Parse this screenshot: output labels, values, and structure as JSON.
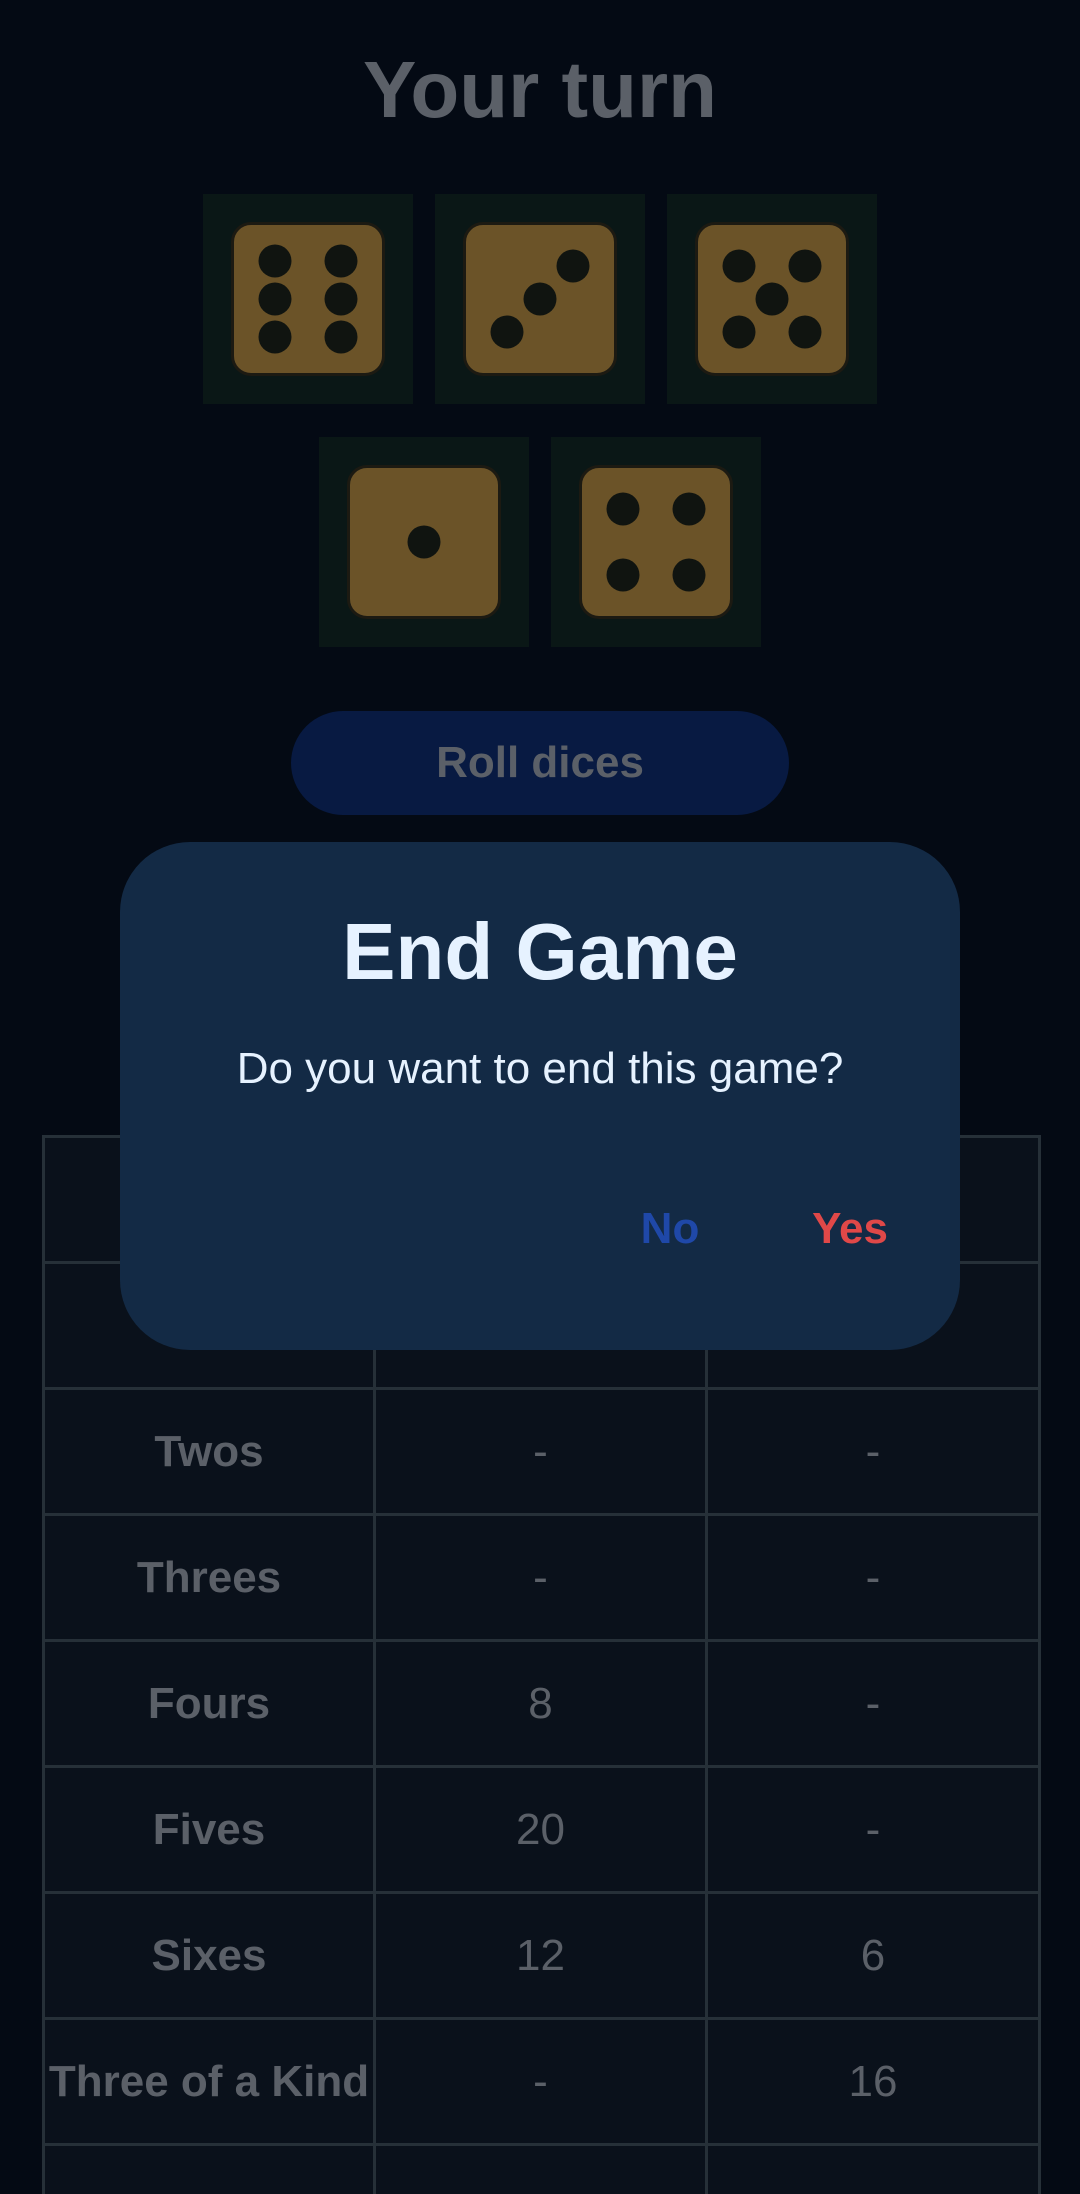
{
  "header": {
    "title": "Your turn"
  },
  "dice": [
    6,
    3,
    5,
    1,
    4
  ],
  "roll_button": {
    "label": "Roll dices"
  },
  "scoreboard": {
    "columns": [
      "",
      "",
      ""
    ],
    "rows": [
      {
        "label": "",
        "p1": "",
        "p2": ""
      },
      {
        "label": "Twos",
        "p1": "-",
        "p2": "-"
      },
      {
        "label": "Threes",
        "p1": "-",
        "p2": "-"
      },
      {
        "label": "Fours",
        "p1": "8",
        "p2": "-"
      },
      {
        "label": "Fives",
        "p1": "20",
        "p2": "-"
      },
      {
        "label": "Sixes",
        "p1": "12",
        "p2": "6"
      },
      {
        "label": "Three of a Kind",
        "p1": "-",
        "p2": "16"
      },
      {
        "label": "",
        "p1": "",
        "p2": ""
      }
    ]
  },
  "dialog": {
    "title": "End Game",
    "message": "Do you want to end this game?",
    "no_label": "No",
    "yes_label": "Yes"
  },
  "colors": {
    "background": "#040a14",
    "dialog": "#132a45",
    "no": "#1f48a8",
    "yes": "#e04848",
    "die": "#6b5328"
  }
}
